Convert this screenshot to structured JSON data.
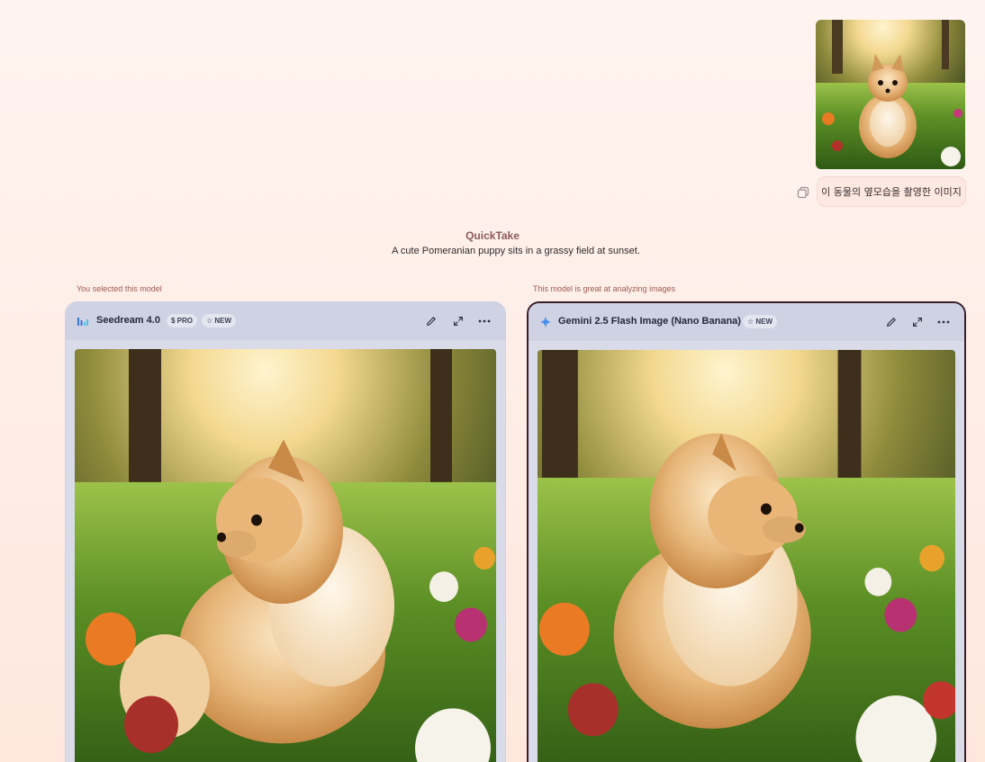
{
  "user_message": {
    "text": "이 동물의 옆모습을 촬영한 이미지",
    "attachment_icon": "puppy-image-thumbnail",
    "copy_icon": "copy-icon"
  },
  "quicktake": {
    "title": "QuickTake",
    "summary": "A cute Pomeranian puppy sits in a grassy field at sunset."
  },
  "cards": [
    {
      "caption": "You selected this model",
      "model_name": "Seedream 4.0",
      "badges": [
        "$ PRO",
        "☆ NEW"
      ],
      "icon": "seedream-bars-icon",
      "actions": [
        "edit-icon",
        "expand-icon",
        "more-icon"
      ]
    },
    {
      "caption": "This model is great at analyzing images",
      "model_name": "Gemini 2.5 Flash Image (Nano Banana)",
      "badges": [
        "☆ NEW"
      ],
      "icon": "gemini-sparkle-icon",
      "actions": [
        "edit-icon",
        "expand-icon",
        "more-icon"
      ]
    }
  ],
  "colors": {
    "selected_border": "#3a1f2a",
    "card_background": "#d9dbe8",
    "caption": "#9a5b52"
  }
}
